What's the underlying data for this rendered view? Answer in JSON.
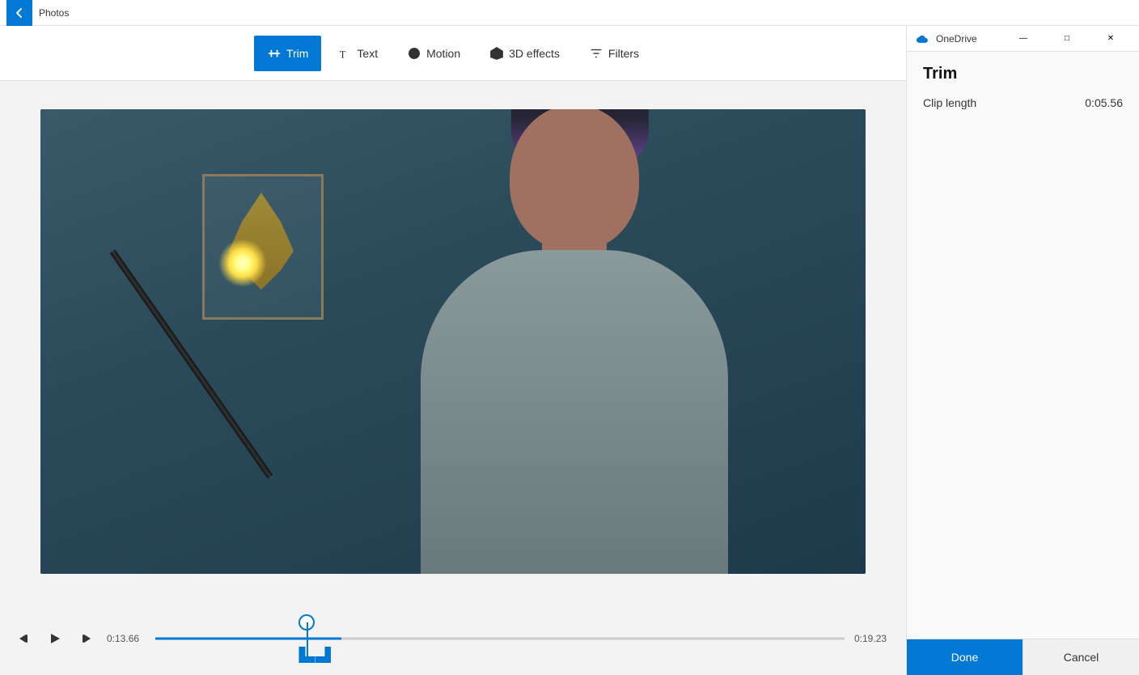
{
  "titleBar": {
    "appName": "Photos",
    "backLabel": "←"
  },
  "toolbar": {
    "buttons": [
      {
        "id": "trim",
        "label": "Trim",
        "active": true
      },
      {
        "id": "text",
        "label": "Text",
        "active": false
      },
      {
        "id": "motion",
        "label": "Motion",
        "active": false
      },
      {
        "id": "3deffects",
        "label": "3D effects",
        "active": false
      },
      {
        "id": "filters",
        "label": "Filters",
        "active": false
      }
    ]
  },
  "sidePanel": {
    "onedrive": {
      "label": "OneDrive"
    },
    "title": "Trim",
    "clipLength": {
      "label": "Clip length",
      "value": "0:05.56"
    },
    "doneLabel": "Done",
    "cancelLabel": "Cancel"
  },
  "timeline": {
    "currentTime": "0:13.66",
    "endTime": "0:19.23",
    "playedPercent": 27
  }
}
